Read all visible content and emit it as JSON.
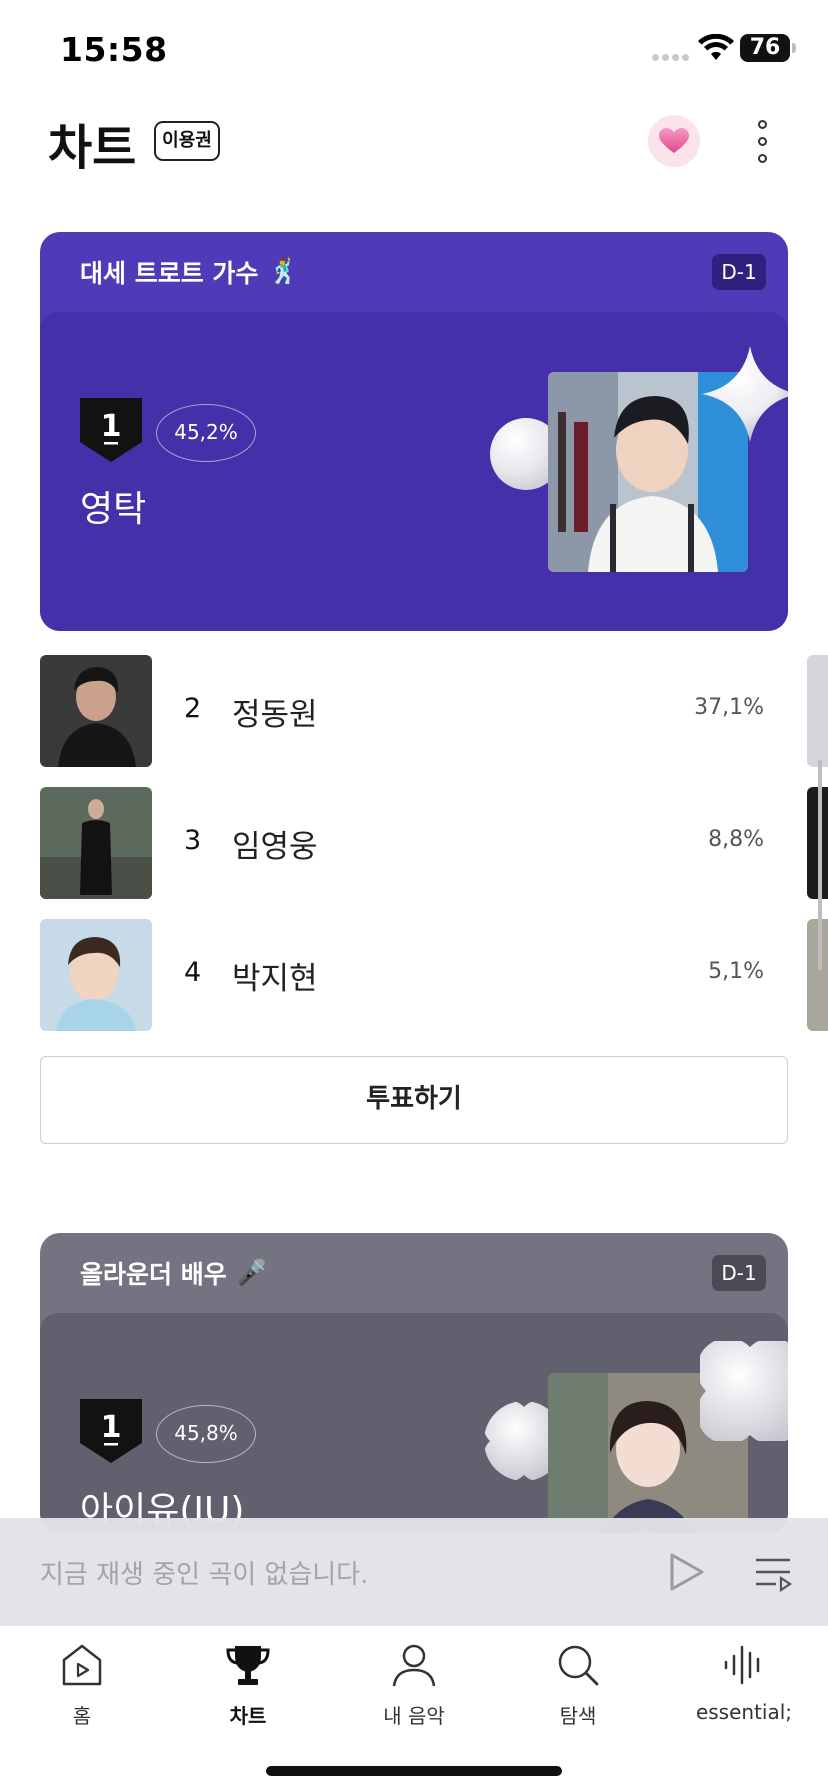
{
  "status_bar": {
    "time": "15:58",
    "battery": "76",
    "icons": [
      "cellular-signal-icon",
      "wifi-icon",
      "battery-icon"
    ]
  },
  "header": {
    "title": "차트",
    "pass_badge": "이용권",
    "heart_icon": "heart-icon",
    "more_icon": "more-vertical-icon"
  },
  "vote_cards": [
    {
      "topic": "대세 트로트 가수",
      "topic_emoji": "🕺",
      "dday": "D-1",
      "rank": "1",
      "percent": "45,2%",
      "name": "영탁",
      "bg_color": "#4f3bb8"
    },
    {
      "topic": "올라운더 배우",
      "topic_emoji": "🎤",
      "dday": "D-1",
      "rank": "1",
      "percent": "45,8%",
      "name": "아이유(IU)",
      "bg_color": "#737382"
    }
  ],
  "ranking": [
    {
      "rank": "2",
      "name": "정동원",
      "percent": "37,1%"
    },
    {
      "rank": "3",
      "name": "임영웅",
      "percent": "8,8%"
    },
    {
      "rank": "4",
      "name": "박지현",
      "percent": "5,1%"
    }
  ],
  "vote_button": "투표하기",
  "mini_player": {
    "message": "지금 재생 중인 곡이 없습니다.",
    "play_icon": "play-icon",
    "queue_icon": "playlist-icon"
  },
  "tabs": [
    {
      "label": "홈",
      "icon": "home-play-icon",
      "active": false
    },
    {
      "label": "차트",
      "icon": "trophy-icon",
      "active": true
    },
    {
      "label": "내 음악",
      "icon": "user-icon",
      "active": false
    },
    {
      "label": "탐색",
      "icon": "search-icon",
      "active": false
    },
    {
      "label": "essential;",
      "icon": "waveform-icon",
      "active": false
    }
  ]
}
